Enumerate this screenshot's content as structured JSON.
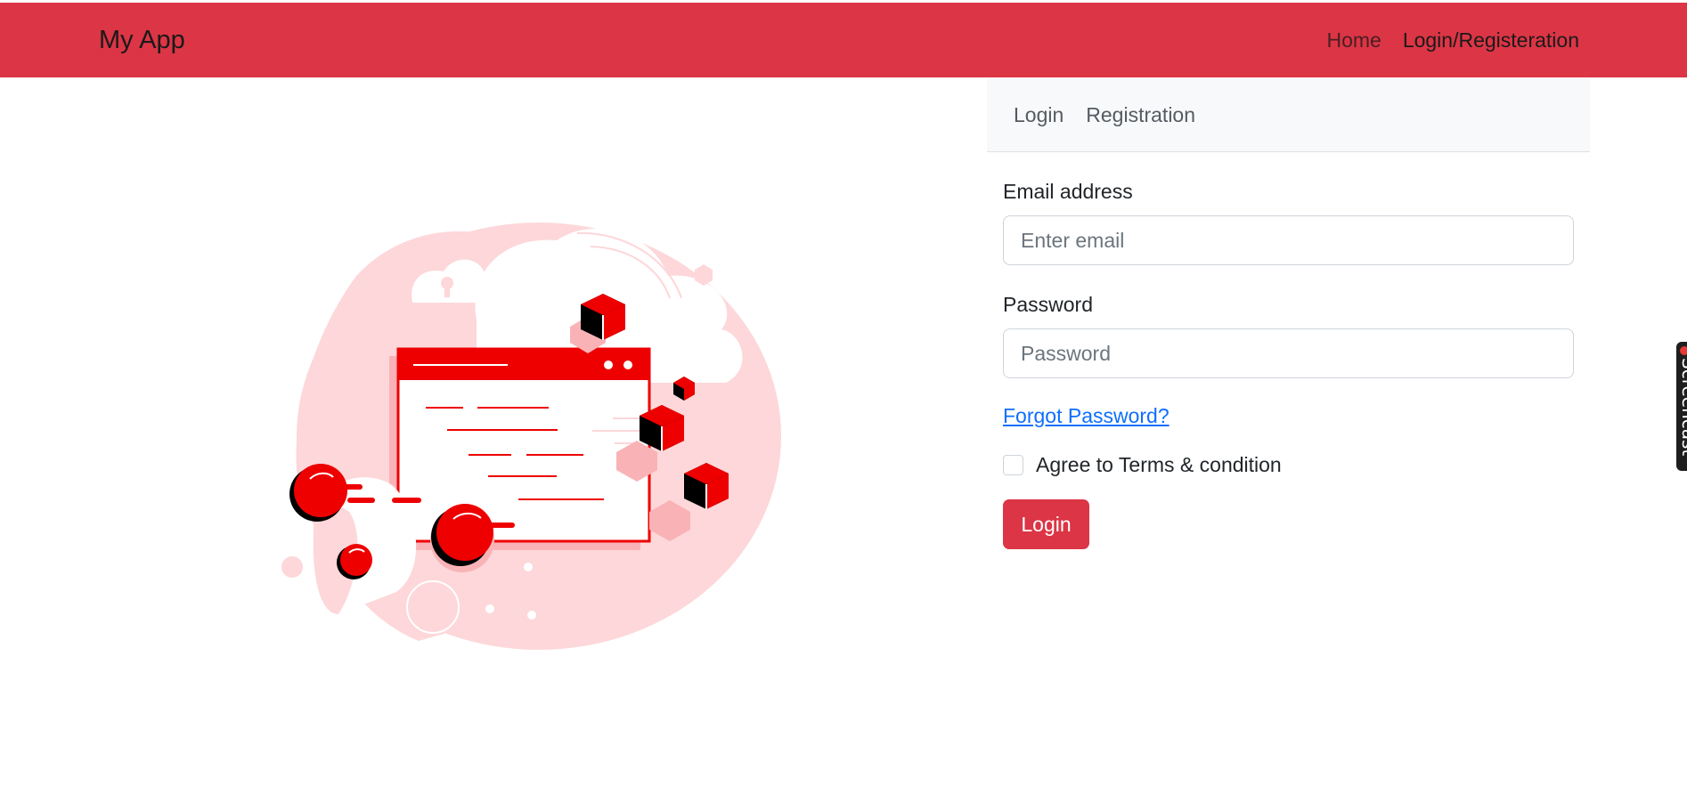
{
  "navbar": {
    "brand": "My App",
    "links": [
      "Home",
      "Login/Registeration"
    ],
    "background": "#dc3545"
  },
  "tabs": [
    "Login",
    "Registration"
  ],
  "form": {
    "email_label": "Email address",
    "email_placeholder": "Enter email",
    "password_label": "Password",
    "password_placeholder": "Password",
    "forgot_link": "Forgot Password?",
    "agree_label": "Agree to Terms & condition",
    "submit_label": "Login"
  },
  "side_widget": {
    "text": "Screencast",
    "icon": "record-icon"
  },
  "colors": {
    "accent": "#dc3545",
    "illustration_red": "#ee0000",
    "illustration_pink": "#fdd7d9",
    "link": "#0d6efd"
  }
}
